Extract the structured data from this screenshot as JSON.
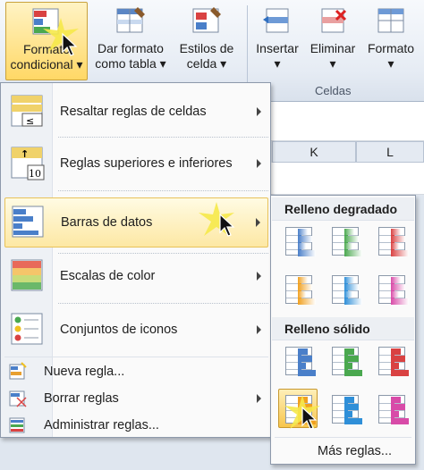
{
  "ribbon": {
    "buttons": [
      {
        "id": "formato-condicional",
        "line1": "Formato",
        "line2": "condicional ▾",
        "active": true
      },
      {
        "id": "dar-formato-tabla",
        "line1": "Dar formato",
        "line2": "como tabla ▾"
      },
      {
        "id": "estilos-celda",
        "line1": "Estilos de",
        "line2": "celda ▾"
      },
      {
        "id": "insertar",
        "line1": "Insertar",
        "line2": "▾"
      },
      {
        "id": "eliminar",
        "line1": "Eliminar",
        "line2": "▾"
      },
      {
        "id": "formato",
        "line1": "Formato",
        "line2": "▾"
      }
    ],
    "group_label": "Celdas"
  },
  "sheet": {
    "col_k": "K",
    "col_l": "L"
  },
  "menu": {
    "items": [
      {
        "label": "Resaltar reglas de celdas",
        "icon": "highlight-cells-rules-icon",
        "submenu": true
      },
      {
        "label": "Reglas superiores e inferiores",
        "icon": "top-bottom-rules-icon",
        "submenu": true
      },
      {
        "label": "Barras de datos",
        "icon": "data-bars-icon",
        "submenu": true,
        "highlighted": true
      },
      {
        "label": "Escalas de color",
        "icon": "color-scales-icon",
        "submenu": true
      },
      {
        "label": "Conjuntos de iconos",
        "icon": "icon-sets-icon",
        "submenu": true
      }
    ],
    "small_items": [
      {
        "label": "Nueva regla...",
        "icon": "new-rule-icon",
        "submenu": false
      },
      {
        "label": "Borrar reglas",
        "icon": "clear-rules-icon",
        "submenu": true
      },
      {
        "label": "Administrar reglas...",
        "icon": "manage-rules-icon",
        "submenu": false
      }
    ]
  },
  "submenu": {
    "gradient_header": "Relleno degradado",
    "solid_header": "Relleno sólido",
    "gradient_colors": [
      "#4a7fc9",
      "#4aa84f",
      "#d94242",
      "#f0a020",
      "#2f8fd8",
      "#d84ba8"
    ],
    "solid_colors": [
      "#4a7fc9",
      "#4aa84f",
      "#d94242",
      "#f0a020",
      "#2f8fd8",
      "#d84ba8"
    ],
    "selected_solid_index": 3,
    "more_rules": "Más reglas..."
  }
}
